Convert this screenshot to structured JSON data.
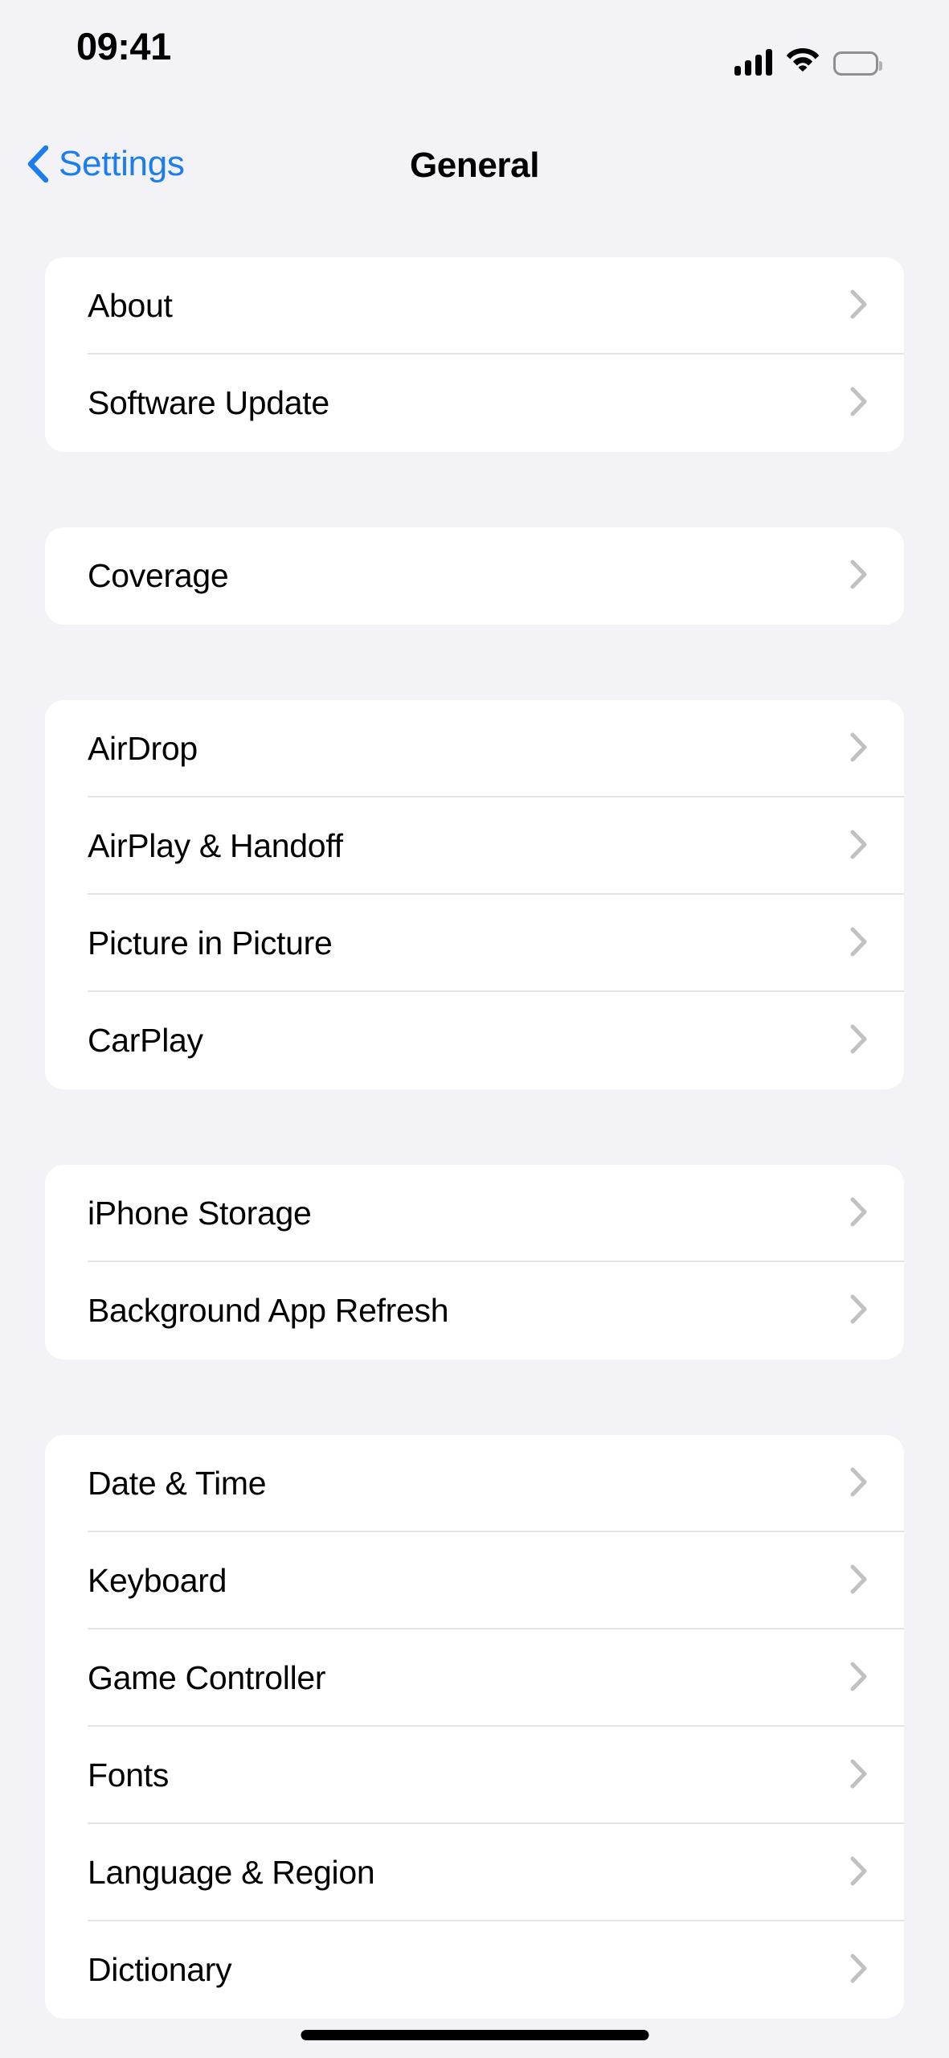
{
  "status_bar": {
    "time": "09:41",
    "cellular_icon": "cellular-signal-icon",
    "wifi_icon": "wifi-icon",
    "battery_icon": "battery-full-icon"
  },
  "nav": {
    "back_label": "Settings",
    "back_icon": "chevron-left-icon",
    "title": "General"
  },
  "colors": {
    "background": "#f2f2f7",
    "card": "#ffffff",
    "accent_blue": "#1c7ded",
    "separator": "#e4e4e7",
    "chevron": "#c1c1c5",
    "label": "#000000"
  },
  "groups": [
    {
      "rows": [
        {
          "label": "About",
          "disclosure": "chevron-right-icon"
        },
        {
          "label": "Software Update",
          "disclosure": "chevron-right-icon"
        }
      ]
    },
    {
      "rows": [
        {
          "label": "Coverage",
          "disclosure": "chevron-right-icon"
        }
      ]
    },
    {
      "rows": [
        {
          "label": "AirDrop",
          "disclosure": "chevron-right-icon"
        },
        {
          "label": "AirPlay & Handoff",
          "disclosure": "chevron-right-icon"
        },
        {
          "label": "Picture in Picture",
          "disclosure": "chevron-right-icon"
        },
        {
          "label": "CarPlay",
          "disclosure": "chevron-right-icon"
        }
      ]
    },
    {
      "rows": [
        {
          "label": "iPhone Storage",
          "disclosure": "chevron-right-icon"
        },
        {
          "label": "Background App Refresh",
          "disclosure": "chevron-right-icon"
        }
      ]
    },
    {
      "rows": [
        {
          "label": "Date & Time",
          "disclosure": "chevron-right-icon"
        },
        {
          "label": "Keyboard",
          "disclosure": "chevron-right-icon"
        },
        {
          "label": "Game Controller",
          "disclosure": "chevron-right-icon"
        },
        {
          "label": "Fonts",
          "disclosure": "chevron-right-icon"
        },
        {
          "label": "Language & Region",
          "disclosure": "chevron-right-icon"
        },
        {
          "label": "Dictionary",
          "disclosure": "chevron-right-icon"
        }
      ]
    }
  ],
  "home_indicator": "home-indicator"
}
